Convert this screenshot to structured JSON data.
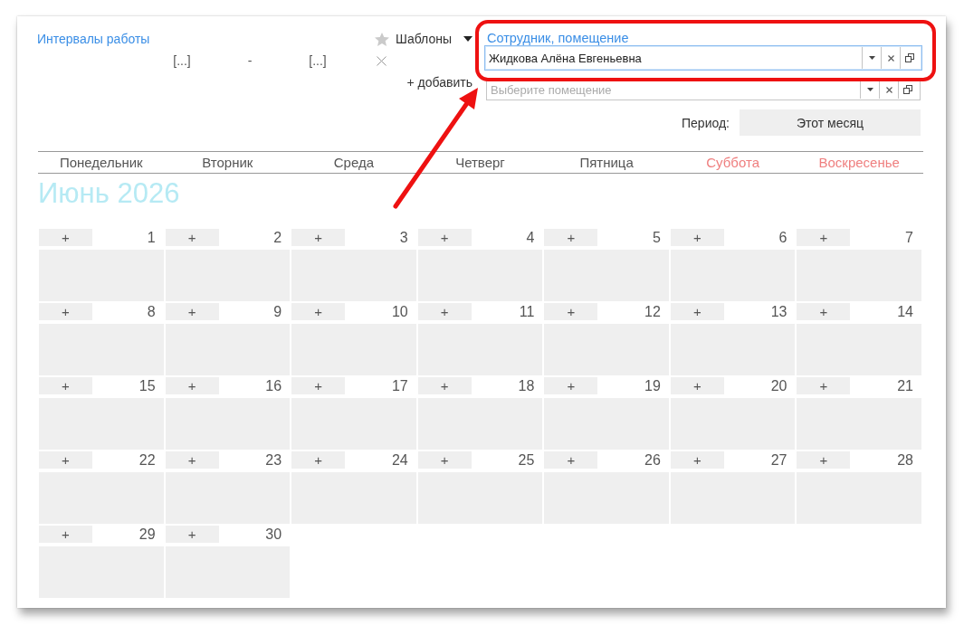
{
  "intervals": {
    "title": "Интервалы работы",
    "templates_button": "Шаблоны",
    "rows": [
      {
        "start": "[...]",
        "separator": "-",
        "end": "[...]"
      }
    ],
    "add_button": "+ добавить"
  },
  "employee_room": {
    "label": "Сотрудник, помещение",
    "fields": [
      {
        "value": "Жидкова Алёна Евгеньевна",
        "focused": true
      },
      {
        "placeholder": "Выберите помещение",
        "focused": false
      }
    ]
  },
  "period": {
    "label": "Период:",
    "button": "Этот месяц"
  },
  "calendar": {
    "weekdays": [
      {
        "label": "Понедельник",
        "weekend": false
      },
      {
        "label": "Вторник",
        "weekend": false
      },
      {
        "label": "Среда",
        "weekend": false
      },
      {
        "label": "Четверг",
        "weekend": false
      },
      {
        "label": "Пятница",
        "weekend": false
      },
      {
        "label": "Суббота",
        "weekend": true
      },
      {
        "label": "Воскресенье",
        "weekend": true
      }
    ],
    "month_title": "Июнь 2026",
    "weeks": [
      [
        {
          "add": "+",
          "day": "1"
        },
        {
          "add": "+",
          "day": "2"
        },
        {
          "add": "+",
          "day": "3"
        },
        {
          "add": "+",
          "day": "4"
        },
        {
          "add": "+",
          "day": "5"
        },
        {
          "add": "+",
          "day": "6"
        },
        {
          "add": "+",
          "day": "7"
        }
      ],
      [
        {
          "add": "+",
          "day": "8"
        },
        {
          "add": "+",
          "day": "9"
        },
        {
          "add": "+",
          "day": "10"
        },
        {
          "add": "+",
          "day": "11"
        },
        {
          "add": "+",
          "day": "12"
        },
        {
          "add": "+",
          "day": "13"
        },
        {
          "add": "+",
          "day": "14"
        }
      ],
      [
        {
          "add": "+",
          "day": "15"
        },
        {
          "add": "+",
          "day": "16"
        },
        {
          "add": "+",
          "day": "17"
        },
        {
          "add": "+",
          "day": "18"
        },
        {
          "add": "+",
          "day": "19"
        },
        {
          "add": "+",
          "day": "20"
        },
        {
          "add": "+",
          "day": "21"
        }
      ],
      [
        {
          "add": "+",
          "day": "22"
        },
        {
          "add": "+",
          "day": "23"
        },
        {
          "add": "+",
          "day": "24"
        },
        {
          "add": "+",
          "day": "25"
        },
        {
          "add": "+",
          "day": "26"
        },
        {
          "add": "+",
          "day": "27"
        },
        {
          "add": "+",
          "day": "28"
        }
      ],
      [
        {
          "add": "+",
          "day": "29"
        },
        {
          "add": "+",
          "day": "30"
        }
      ]
    ]
  }
}
